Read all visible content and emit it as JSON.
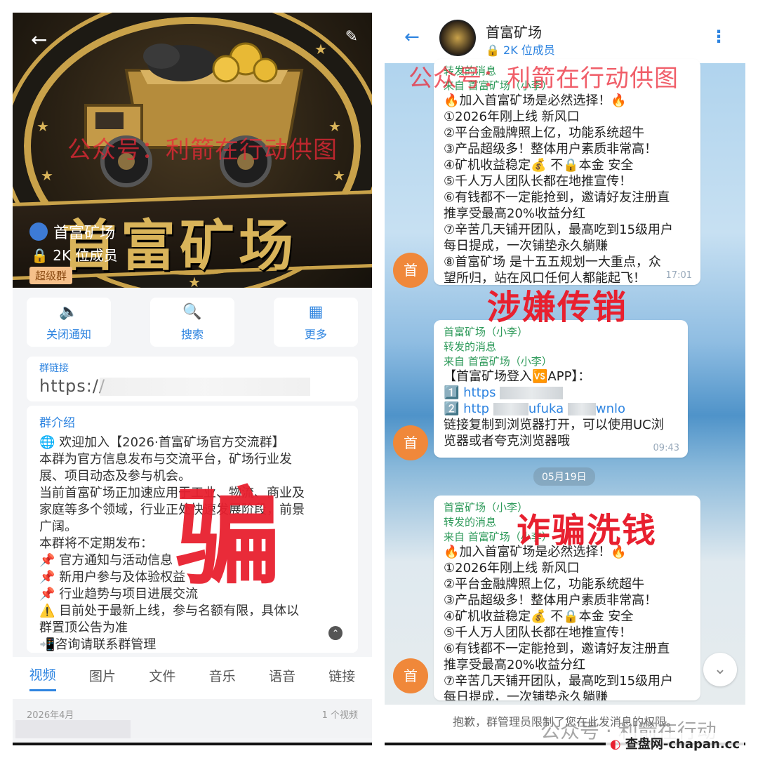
{
  "group": {
    "name": "首富矿场",
    "members": "2K 位成员",
    "badge": "超级群",
    "banner_text": "首富矿场"
  },
  "left": {
    "actions": [
      {
        "icon": "speaker-icon",
        "label": "关闭通知"
      },
      {
        "icon": "search-doc-icon",
        "label": "搜索"
      },
      {
        "icon": "grid-icon",
        "label": "更多"
      }
    ],
    "link_title": "群链接",
    "link_value": "https://",
    "intro_title": "群介绍",
    "intro_lines": [
      "🌐 欢迎加入【2026·首富矿场官方交流群】",
      "本群为官方信息发布与交流平台，矿场行业发",
      "展、项目动态及参与机会。",
      "当前首富矿场正加速应用于工业、物流、商业及",
      "家庭等多个领域，行业正处快速发展阶段，前景",
      "广阔。",
      "本群将不定期发布：",
      "📌 官方通知与活动信息",
      "📌 新用户参与及体验权益",
      "📌 行业趋势与项目进展交流",
      "⚠️ 目前处于最新上线，参与名额有限，具体以",
      "群置顶公告为准",
      "📲咨询请联系群管理"
    ],
    "tabs": [
      "视频",
      "图片",
      "文件",
      "音乐",
      "语音",
      "链接"
    ],
    "section_date": "2026年4月",
    "section_count": "1 个视频"
  },
  "right": {
    "msg1": {
      "fwd": "转发的消息",
      "from": "来自 首富矿场（小李）",
      "lines": [
        "🔥加入首富矿场是必然选择！🔥",
        "①2026年刚上线 新风口",
        "②平台金融牌照上亿，功能系统超牛",
        "③产品超级多！整体用户素质非常高！",
        "④矿机收益稳定💰 不🔒本金 安全",
        "⑤千人万人团队长都在地推宣传！",
        "⑥有钱都不一定能抢到，邀请好友注册直",
        "推享受最高20%收益分红",
        "⑦辛苦几天铺开团队，最高吃到15级用户",
        "每日提成，一次铺垫永久躺赚",
        "⑧首富矿场 是十五五规划一大重点，众",
        "望所归，站在风口任何人都能起飞！"
      ],
      "time": "17:01"
    },
    "msg2": {
      "sender": "首富矿场（小李）",
      "fwd": "转发的消息",
      "from": "来自 首富矿场（小李）",
      "title": "【首富矿场登入🆚APP】：",
      "link1": "1️⃣ https",
      "link2": "2️⃣ http",
      "link2_tail": "ufuka",
      "link2_end": "wnlo",
      "tip1": "链接复制到浏览器打开，可以使用UC浏",
      "tip2": "览器或者夸克浏览器哦",
      "time": "09:43"
    },
    "date_chip": "05月19日",
    "msg3": {
      "sender": "首富矿场（小李）",
      "fwd": "转发的消息",
      "from": "来自 首富矿场（小李）",
      "lines": [
        "🔥加入首富矿场是必然选择！🔥",
        "①2026年刚上线 新风口",
        "②平台金融牌照上亿，功能系统超牛",
        "③产品超级多！整体用户素质非常高！",
        "④矿机收益稳定💰 不🔒本金 安全",
        "⑤千人万人团队长都在地推宣传！",
        "⑥有钱都不一定能抢到，邀请好友注册直",
        "推享受最高20%收益分红",
        "⑦辛苦几天铺开团队，最高吃到15级用户",
        "每日提成，一次铺垫永久躺赚"
      ]
    },
    "avatar_letter": "首",
    "notice": "抱歉，群管理员限制了您在此发消息的权限。"
  },
  "overlays": {
    "watermark": "公众号：利箭在行动供图",
    "fraud": "骗",
    "mlm": "涉嫌传销",
    "laundering": "诈骗洗钱",
    "footer_watermark": "公众号 · 利箭在行动",
    "site": "查盘网-chapan.cc"
  },
  "colors": {
    "accent": "#2e84e0",
    "alert_red": "#e8202f",
    "avatar_orange": "#f0883a",
    "gold": "#c9a24a"
  }
}
